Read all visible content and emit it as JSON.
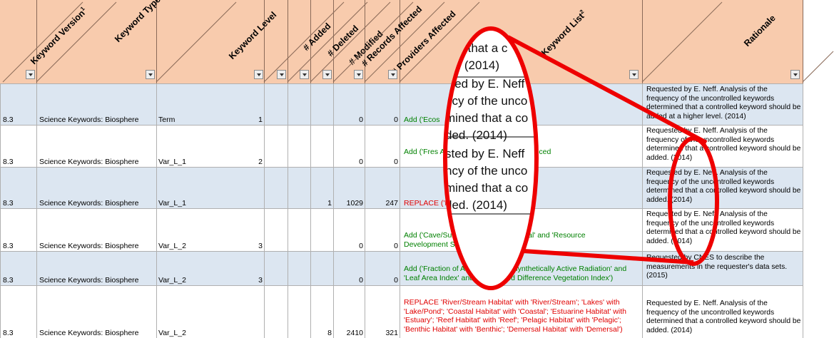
{
  "headers": {
    "keyword_version": "Keyword Version",
    "keyword_version_sup": "1",
    "keyword_type": "Keyword Type",
    "keyword_level": "Keyword Level",
    "added": "# Added",
    "deleted": "# Deleted",
    "modified": "# Modified",
    "records_affected": "# Records Affected",
    "providers_affected": "# Providers Affected",
    "keyword_list": "Keyword List",
    "keyword_list_sup": "2",
    "rationale": "Rationale"
  },
  "rows": [
    {
      "version": "8.3",
      "type": "Science Keywords: Biosphere",
      "level_name": "Term",
      "level": "1",
      "added": "",
      "deleted": "",
      "modified": "0",
      "records": "0",
      "keyword_list": "Add ('Ecos",
      "rationale": "Requested by E. Neff. Analysis of the frequency of the uncontrolled keywords determined that a controlled keyword should be added at a higher level. (2014)"
    },
    {
      "version": "8.3",
      "type": "Science Keywords: Biosphere",
      "level_name": "Var_L_1",
      "level": "2",
      "added": "",
      "deleted": "",
      "modified": "0",
      "records": "0",
      "keyword_list": "Add ('Fres  Anthropogenic/Human Influenced",
      "rationale": "Requested by E. Neff. Analysis of the frequency of the uncontrolled keywords determined that a controlled keyword should be added. (2014)"
    },
    {
      "version": "8.3",
      "type": "Science Keywords: Biosphere",
      "level_name": "Var_L_1",
      "level": "",
      "added": "",
      "deleted": "1",
      "modified": "1029",
      "records": "247",
      "keyword_list": "REPLACE ('Mari  arine Ecosystems')",
      "rationale": "Requested by E. Neff. Analysis of the frequency of the uncontrolled keywords determined that a controlled keyword should be added. (2014)"
    },
    {
      "version": "8.3",
      "type": "Science Keywords: Biosphere",
      "level_name": "Var_L_2",
      "level": "3",
      "added": "",
      "deleted": "",
      "modified": "0",
      "records": "0",
      "keyword_list": "Add ('Cave/Subterranean' and 'Abyssal' and 'Resource Development Site' )",
      "rationale": "Requested by E. Neff. Analysis of the frequency of the uncontrolled keywords determined that a controlled keyword should be added. (2014)"
    },
    {
      "version": "8.3",
      "type": "Science Keywords: Biosphere",
      "level_name": "Var_L_2",
      "level": "3",
      "added": "",
      "deleted": "",
      "modified": "0",
      "records": "0",
      "keyword_list": "Add ('Fraction of Absorbed Photosynthetically Active Radiation' and 'Leaf Area Index' and 'Normalized Difference Vegetation Index')",
      "rationale": "Requested by CNES to describe the measurements in the requester's data sets. (2015)"
    },
    {
      "version": "8.3",
      "type": "Science Keywords: Biosphere",
      "level_name": "Var_L_2",
      "level": "",
      "added": "",
      "deleted": "8",
      "modified": "2410",
      "records": "321",
      "keyword_list": "REPLACE 'River/Stream Habitat' with 'River/Stream'; 'Lakes' with 'Lake/Pond'; 'Coastal Habitat' with 'Coastal'; 'Estuarine Habitat' with 'Estuary'; 'Reef Habitat' with 'Reef'; 'Pelagic Habitat' with 'Pelagic'; 'Benthic Habitat' with 'Benthic'; 'Demersal Habitat' with 'Demersal')",
      "rationale": "Requested by E. Neff. Analysis of the frequency of the uncontrolled keywords determined that a controlled keyword should be added. (2014)"
    }
  ],
  "zoom_lines": [
    "sted by E. Neff",
    "ncy of the unco",
    "mined that a co",
    "ded. (2014)"
  ],
  "zoom_top_lines": [
    "ed that a c",
    "d. (2014)"
  ],
  "colors": {
    "header": "#f8cbad",
    "band": "#dce6f1",
    "callout": "#ee0000",
    "add": "#008000",
    "replace": "#e00000"
  }
}
